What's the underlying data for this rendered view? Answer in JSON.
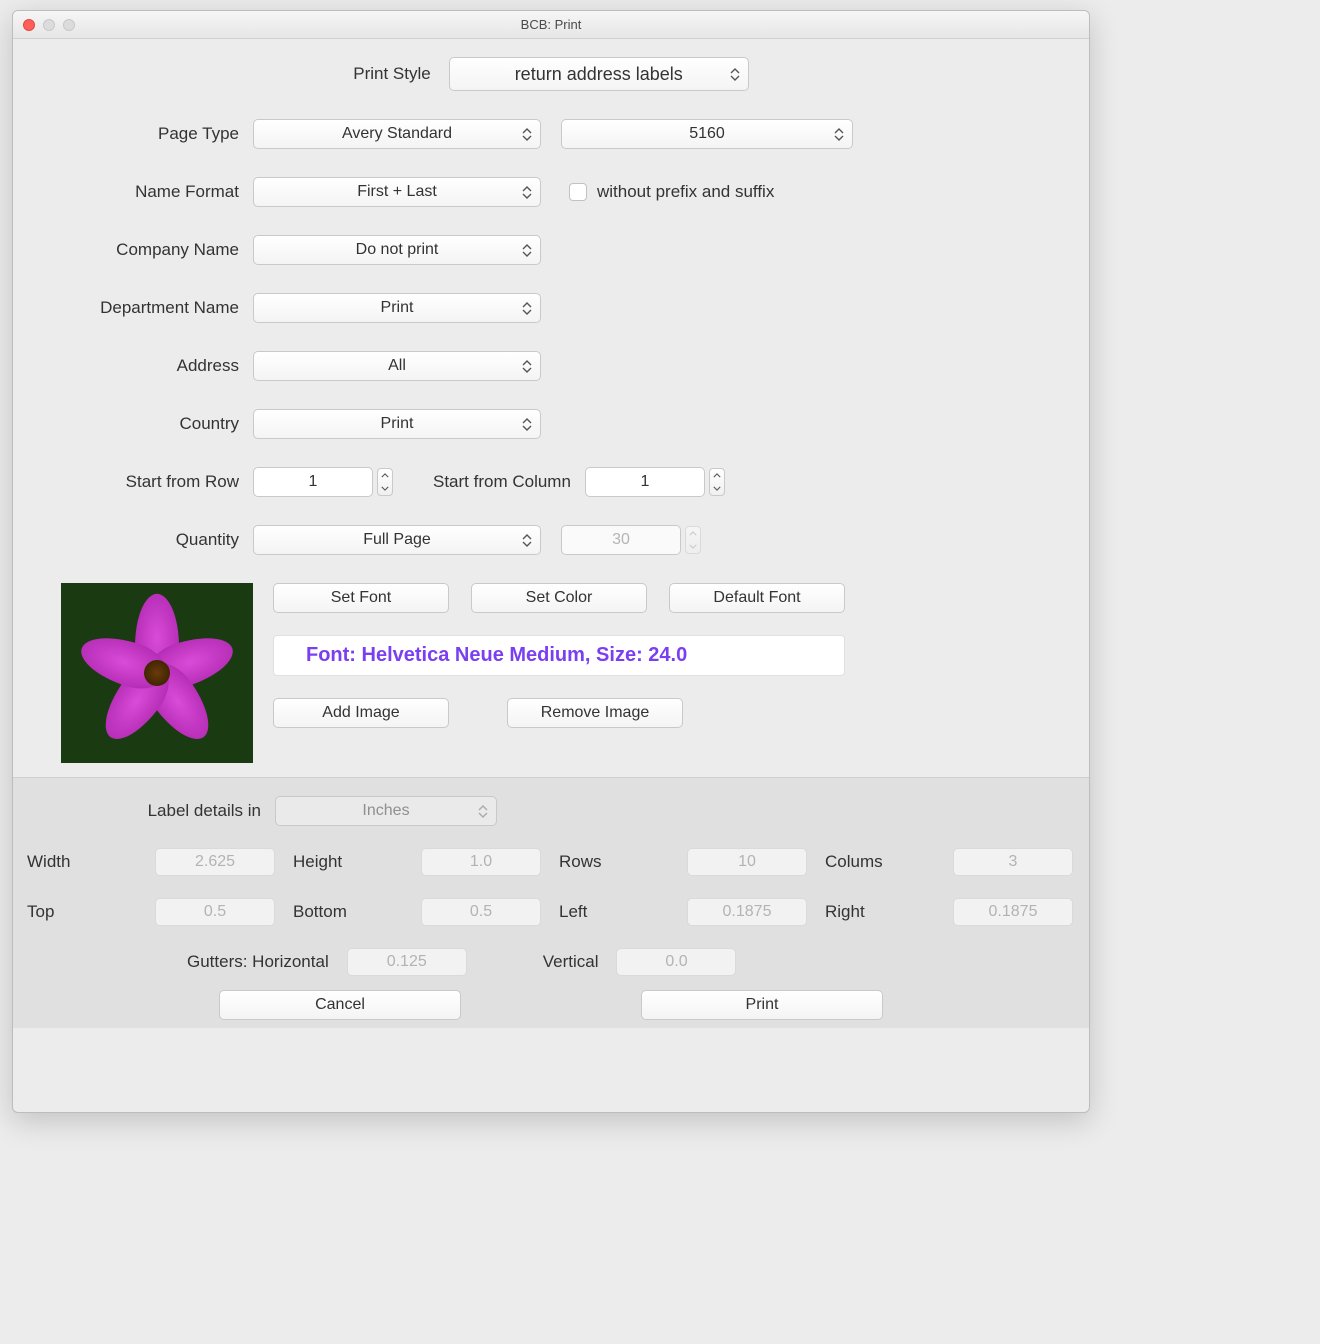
{
  "window_title": "BCB: Print",
  "labels": {
    "print_style": "Print Style",
    "page_type": "Page Type",
    "name_format": "Name Format",
    "company_name": "Company Name",
    "department_name": "Department Name",
    "address": "Address",
    "country": "Country",
    "start_row": "Start from Row",
    "start_col": "Start from Column",
    "quantity": "Quantity",
    "without_prefix": "without prefix and suffix",
    "label_details_in": "Label details in",
    "width": "Width",
    "height": "Height",
    "rows": "Rows",
    "cols": "Colums",
    "top": "Top",
    "bottom": "Bottom",
    "left": "Left",
    "right": "Right",
    "gutters_h": "Gutters: Horizontal",
    "gutters_v": "Vertical"
  },
  "values": {
    "print_style": "return address labels",
    "page_type_vendor": "Avery Standard",
    "page_type_model": "5160",
    "name_format": "First + Last",
    "company_name": "Do not print",
    "department_name": "Print",
    "address": "All",
    "country": "Print",
    "start_row": "1",
    "start_col": "1",
    "quantity": "Full Page",
    "quantity_n": "30",
    "units": "Inches",
    "width": "2.625",
    "height": "1.0",
    "rows": "10",
    "cols": "3",
    "top": "0.5",
    "bottom": "0.5",
    "left": "0.1875",
    "right": "0.1875",
    "gutter_h": "0.125",
    "gutter_v": "0.0"
  },
  "buttons": {
    "set_font": "Set Font",
    "set_color": "Set Color",
    "default_font": "Default Font",
    "add_image": "Add Image",
    "remove_image": "Remove Image",
    "cancel": "Cancel",
    "print": "Print"
  },
  "font_line": "Font: Helvetica Neue Medium, Size: 24.0"
}
